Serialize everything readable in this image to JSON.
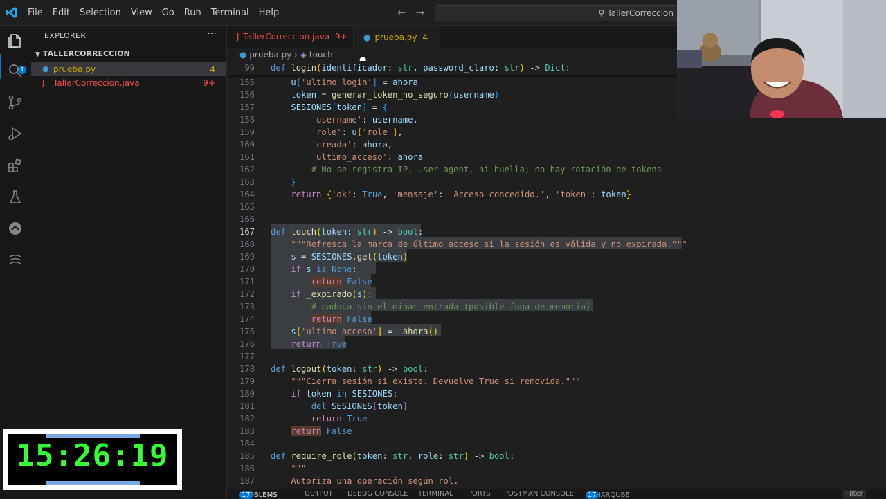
{
  "menu": [
    "File",
    "Edit",
    "Selection",
    "View",
    "Go",
    "Run",
    "Terminal",
    "Help"
  ],
  "search": {
    "text": "TallerCorreccion"
  },
  "explorer": {
    "title": "EXPLORER",
    "folder": "TALLERCORRECCION",
    "files": [
      {
        "name": "prueba.py",
        "count": "4"
      },
      {
        "name": "TallerCorreccion.java",
        "count": "9+"
      }
    ]
  },
  "activity_badge": "1",
  "tabs": [
    {
      "label": "TallerCorreccion.java",
      "count": "9+"
    },
    {
      "label": "prueba.py",
      "count": "4"
    }
  ],
  "breadcrumb": {
    "file": "prueba.py",
    "symbol": "touch"
  },
  "sticky": {
    "num": "99"
  },
  "line_numbers": [
    "155",
    "156",
    "157",
    "158",
    "159",
    "160",
    "161",
    "162",
    "163",
    "164",
    "165",
    "166",
    "167",
    "168",
    "169",
    "170",
    "171",
    "172",
    "173",
    "174",
    "175",
    "176",
    "177",
    "178",
    "179",
    "180",
    "181",
    "182",
    "183",
    "184",
    "185",
    "186",
    "187"
  ],
  "panel_tabs": [
    {
      "label": "PROBLEMS",
      "badge": "17"
    },
    {
      "label": "OUTPUT"
    },
    {
      "label": "DEBUG CONSOLE"
    },
    {
      "label": "TERMINAL"
    },
    {
      "label": "PORTS"
    },
    {
      "label": "POSTMAN CONSOLE"
    },
    {
      "label": "SONARQUBE",
      "badge": "17"
    }
  ],
  "panel_right": "Filter",
  "timer": "15:26:19",
  "colors": {
    "accent": "#0078d4",
    "timer": "#33ff33",
    "keyword": "#569cd6",
    "function": "#dcdcaa",
    "string": "#ce9178",
    "comment": "#6a9955"
  }
}
